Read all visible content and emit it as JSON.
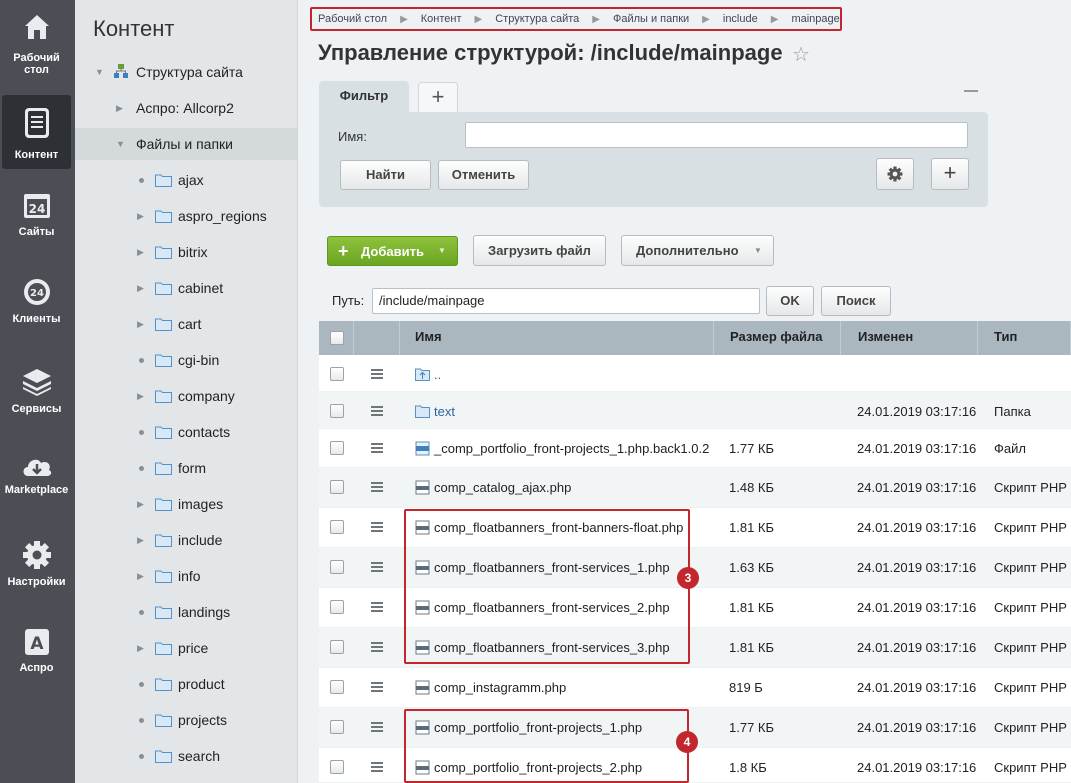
{
  "leftbar": {
    "items": [
      {
        "label": "Рабочий стол",
        "icon": "home-icon"
      },
      {
        "label": "Контент",
        "icon": "document-icon"
      },
      {
        "label": "Сайты",
        "icon": "calendar-24-icon"
      },
      {
        "label": "Клиенты",
        "icon": "clients-24-icon"
      },
      {
        "label": "Сервисы",
        "icon": "layers-icon"
      },
      {
        "label": "Marketplace",
        "icon": "cloud-download-icon"
      },
      {
        "label": "Настройки",
        "icon": "gear-icon"
      },
      {
        "label": "Аспро",
        "icon": "aspro-a-icon"
      }
    ]
  },
  "panel": {
    "title": "Контент",
    "tree": [
      {
        "label": "Структура сайта"
      },
      {
        "label": "Аспро: Allcorp2"
      },
      {
        "label": "Файлы и папки"
      },
      {
        "label": "ajax"
      },
      {
        "label": "aspro_regions"
      },
      {
        "label": "bitrix"
      },
      {
        "label": "cabinet"
      },
      {
        "label": "cart"
      },
      {
        "label": "cgi-bin"
      },
      {
        "label": "company"
      },
      {
        "label": "contacts"
      },
      {
        "label": "form"
      },
      {
        "label": "images"
      },
      {
        "label": "include"
      },
      {
        "label": "info"
      },
      {
        "label": "landings"
      },
      {
        "label": "price"
      },
      {
        "label": "product"
      },
      {
        "label": "projects"
      },
      {
        "label": "search"
      }
    ]
  },
  "breadcrumb": [
    "Рабочий стол",
    "Контент",
    "Структура сайта",
    "Файлы и папки",
    "include",
    "mainpage"
  ],
  "page_title": "Управление структурой: /include/mainpage",
  "filter": {
    "tab_label": "Фильтр",
    "name_label": "Имя:",
    "find_label": "Найти",
    "cancel_label": "Отменить"
  },
  "toolbar": {
    "add_label": "Добавить",
    "upload_label": "Загрузить файл",
    "more_label": "Дополнительно"
  },
  "path": {
    "label": "Путь:",
    "value": "/include/mainpage",
    "ok_label": "OK",
    "search_label": "Поиск"
  },
  "grid": {
    "columns": [
      "Имя",
      "Размер файла",
      "Изменен",
      "Тип"
    ],
    "rows": [
      {
        "name": "..",
        "size": "",
        "date": "",
        "type": "",
        "kind": "up"
      },
      {
        "name": "text",
        "size": "",
        "date": "24.01.2019 03:17:16",
        "type": "Папка",
        "kind": "folder"
      },
      {
        "name": "_comp_portfolio_front-projects_1.php.back1.0.2",
        "size": "1.77 КБ",
        "date": "24.01.2019 03:17:16",
        "type": "Файл",
        "kind": "file"
      },
      {
        "name": "comp_catalog_ajax.php",
        "size": "1.48 КБ",
        "date": "24.01.2019 03:17:16",
        "type": "Скрипт PHP",
        "kind": "php"
      },
      {
        "name": "comp_floatbanners_front-banners-float.php",
        "size": "1.81 КБ",
        "date": "24.01.2019 03:17:16",
        "type": "Скрипт PHP",
        "kind": "php"
      },
      {
        "name": "comp_floatbanners_front-services_1.php",
        "size": "1.63 КБ",
        "date": "24.01.2019 03:17:16",
        "type": "Скрипт PHP",
        "kind": "php"
      },
      {
        "name": "comp_floatbanners_front-services_2.php",
        "size": "1.81 КБ",
        "date": "24.01.2019 03:17:16",
        "type": "Скрипт PHP",
        "kind": "php"
      },
      {
        "name": "comp_floatbanners_front-services_3.php",
        "size": "1.81 КБ",
        "date": "24.01.2019 03:17:16",
        "type": "Скрипт PHP",
        "kind": "php"
      },
      {
        "name": "comp_instagramm.php",
        "size": "819 Б",
        "date": "24.01.2019 03:17:16",
        "type": "Скрипт PHP",
        "kind": "php"
      },
      {
        "name": "comp_portfolio_front-projects_1.php",
        "size": "1.77 КБ",
        "date": "24.01.2019 03:17:16",
        "type": "Скрипт PHP",
        "kind": "php"
      },
      {
        "name": "comp_portfolio_front-projects_2.php",
        "size": "1.8 КБ",
        "date": "24.01.2019 03:17:16",
        "type": "Скрипт PHP",
        "kind": "php"
      }
    ]
  },
  "annotations": {
    "badge_3": "3",
    "badge_4": "4"
  },
  "colors": {
    "highlight": "#c1272d",
    "add_button": "#7ab42e",
    "sidebar": "#4b4f55"
  }
}
